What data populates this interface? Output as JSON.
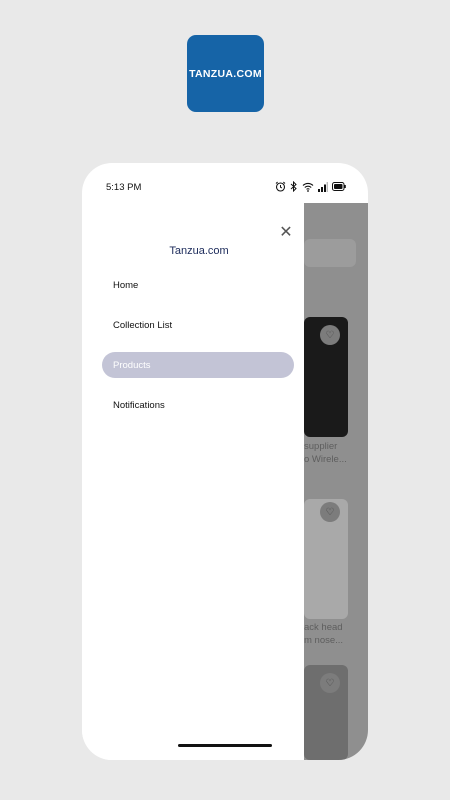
{
  "logo": {
    "text": "TANZUA.COM",
    "color": "#1664a7"
  },
  "status_bar": {
    "time": "5:13 PM",
    "icons": [
      "alarm-icon",
      "bluetooth-icon",
      "wifi-icon",
      "signal-icon",
      "battery-icon"
    ]
  },
  "drawer": {
    "title": "Tanzua.com",
    "close_icon": "close-icon",
    "items": [
      {
        "label": "Home",
        "active": false
      },
      {
        "label": "Collection List",
        "active": false
      },
      {
        "label": "Products",
        "active": true
      },
      {
        "label": "Notifications",
        "active": false
      }
    ],
    "active_color": "#c3c4d6"
  },
  "background_products": [
    {
      "line1": "supplier",
      "line2": "o Wirele..."
    },
    {
      "line1": "ack head",
      "line2": "m nose..."
    },
    {
      "line1": "",
      "line2": ""
    }
  ]
}
